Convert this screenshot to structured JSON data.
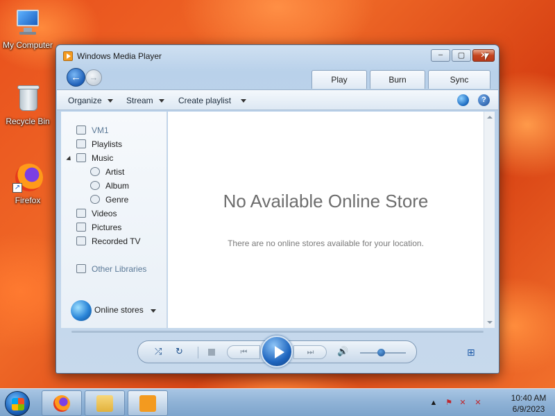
{
  "desktop": {
    "icons": [
      {
        "label": "My Computer"
      },
      {
        "label": "Recycle Bin"
      },
      {
        "label": "Firefox"
      }
    ]
  },
  "window": {
    "title": "Windows Media Player",
    "caption_buttons": {
      "minimize": "–",
      "restore": "▢",
      "close": "✕"
    },
    "nav": {
      "back": "←",
      "forward": "→"
    },
    "tabs": [
      {
        "label": "Play"
      },
      {
        "label": "Burn"
      },
      {
        "label": "Sync"
      }
    ],
    "toolbar": {
      "organize": "Organize",
      "stream": "Stream",
      "create_playlist": "Create playlist",
      "help": "?"
    },
    "nav_pane": {
      "items": [
        {
          "label": "VM1"
        },
        {
          "label": "Playlists"
        },
        {
          "label": "Music"
        },
        {
          "label": "Artist"
        },
        {
          "label": "Album"
        },
        {
          "label": "Genre"
        },
        {
          "label": "Videos"
        },
        {
          "label": "Pictures"
        },
        {
          "label": "Recorded TV"
        },
        {
          "label": "Other Libraries"
        }
      ],
      "online_stores": "Online stores"
    },
    "main": {
      "title": "No Available Online Store",
      "message": "There are no online stores available for your location."
    },
    "controls": {
      "shuffle": "⤮",
      "repeat": "↻",
      "previous": "⏮",
      "next": "⏭",
      "volume": "🔊",
      "switch_to_now_playing": "⊞"
    }
  },
  "taskbar": {
    "time": "10:40 AM",
    "date": "6/9/2023",
    "tray": {
      "show_hidden": "▲",
      "network": "✕",
      "action_center": "⚑",
      "volume": "✕"
    }
  }
}
